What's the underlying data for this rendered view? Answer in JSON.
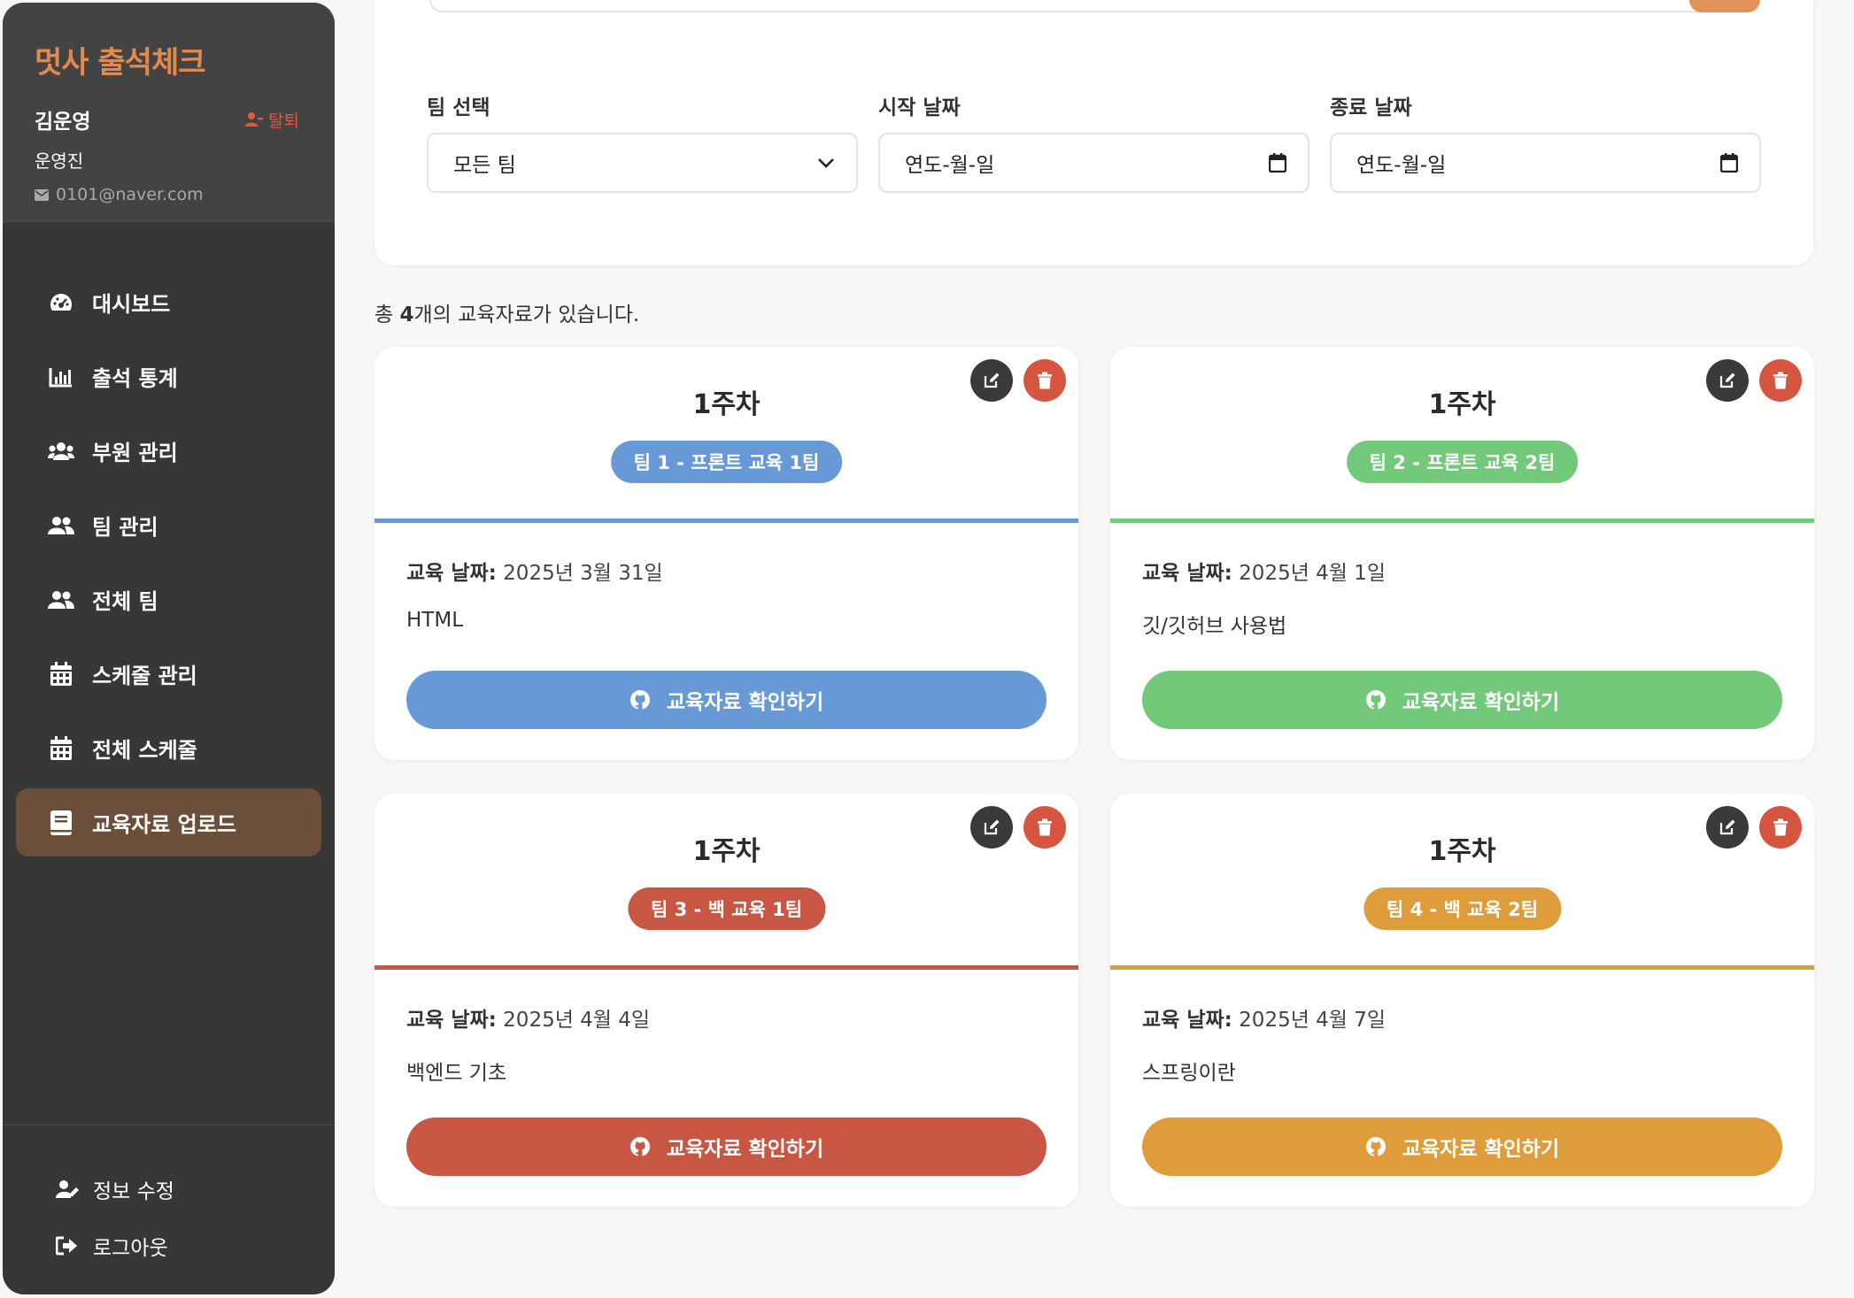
{
  "sidebar": {
    "brand": "멋사 출석체크",
    "user_name": "김운영",
    "withdraw_label": "탈퇴",
    "role": "운영진",
    "email": "0101@naver.com",
    "nav": [
      {
        "label": "대시보드",
        "icon": "dashboard-gauge-icon"
      },
      {
        "label": "출석 통계",
        "icon": "bar-chart-icon"
      },
      {
        "label": "부원 관리",
        "icon": "users-icon"
      },
      {
        "label": "팀 관리",
        "icon": "user-group-icon"
      },
      {
        "label": "전체 팀",
        "icon": "user-group-icon"
      },
      {
        "label": "스케줄 관리",
        "icon": "calendar-icon"
      },
      {
        "label": "전체 스케줄",
        "icon": "calendar-icon"
      },
      {
        "label": "교육자료 업로드",
        "icon": "book-icon",
        "active": true
      }
    ],
    "footer": [
      {
        "label": "정보 수정",
        "icon": "user-edit-icon"
      },
      {
        "label": "로그아웃",
        "icon": "sign-out-icon"
      }
    ]
  },
  "filters": {
    "team_label": "팀 선택",
    "team_value": "모든 팀",
    "start_label": "시작 날짜",
    "start_placeholder": "연도-월-일",
    "end_label": "종료 날짜",
    "end_placeholder": "연도-월-일"
  },
  "summary": {
    "prefix": "총 ",
    "count": "4",
    "suffix": "개의 교육자료가 있습니다."
  },
  "date_label": "교육 날짜:",
  "button_label": "교육자료 확인하기",
  "cards": [
    {
      "week": "1주차",
      "team": "팀 1 - 프론트 교육 1팀",
      "date": "2025년 3월 31일",
      "topic": "HTML",
      "color": "#6699d6"
    },
    {
      "week": "1주차",
      "team": "팀 2 - 프론트 교육 2팀",
      "date": "2025년 4월 1일",
      "topic": "깃/깃허브 사용법",
      "color": "#73c97a"
    },
    {
      "week": "1주차",
      "team": "팀 3 - 백 교육 1팀",
      "date": "2025년 4월 4일",
      "topic": "백엔드 기초",
      "color": "#c95643"
    },
    {
      "week": "1주차",
      "team": "팀 4 - 백 교육 2팀",
      "date": "2025년 4월 7일",
      "topic": "스프링이란",
      "color": "#de9c3a"
    }
  ]
}
